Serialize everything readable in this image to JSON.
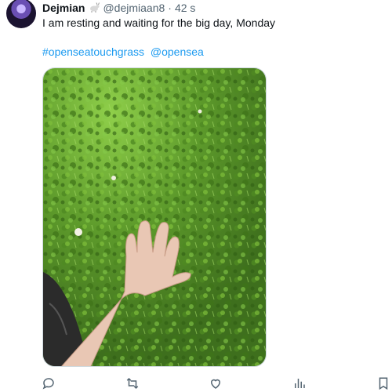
{
  "post": {
    "author_name": "Dejmian",
    "author_handle": "@dejmiaan8",
    "separator": "·",
    "time_ago": "42 s",
    "text": "I am resting and waiting for the big day, Monday",
    "hashtags": [
      "#openseatouchgrass",
      "@opensea"
    ]
  },
  "icons": {
    "badge": "goat-emoji-icon",
    "reply": "reply-icon",
    "repost": "repost-icon",
    "like": "heart-icon",
    "views": "views-icon",
    "bookmark": "bookmark-icon"
  },
  "colors": {
    "link": "#1d9bf0",
    "secondary_text": "#536471",
    "primary_text": "#0f1419"
  }
}
